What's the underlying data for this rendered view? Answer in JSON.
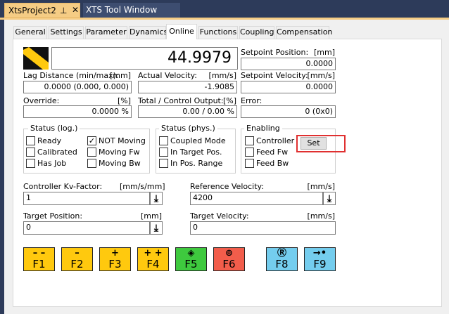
{
  "doc_tabs": [
    {
      "label": "XtsProject2",
      "pin": "⊥",
      "close": "✕"
    },
    {
      "label": "XTS Tool Window"
    }
  ],
  "prop_tabs": [
    "General",
    "Settings",
    "Parameter",
    "Dynamics",
    "Online",
    "Functions",
    "Coupling",
    "Compensation"
  ],
  "active_tab": "Online",
  "online": {
    "main_value": "44.9979",
    "setpoint_position": {
      "label": "Setpoint Position:",
      "unit": "[mm]",
      "value": "0.0000"
    },
    "lag_distance": {
      "label": "Lag Distance (min/max):",
      "unit": "[mm]",
      "value": "0.0000  (0.000, 0.000)"
    },
    "actual_velocity": {
      "label": "Actual Velocity:",
      "unit": "[mm/s]",
      "value": "-1.9085"
    },
    "setpoint_velocity": {
      "label": "Setpoint Velocity:",
      "unit": "[mm/s]",
      "value": "0.0000"
    },
    "override": {
      "label": "Override:",
      "unit": "[%]",
      "value": "0.0000 %"
    },
    "total_output": {
      "label": "Total / Control Output:",
      "unit": "[%]",
      "value": "0.00 /  0.00 %"
    },
    "error": {
      "label": "Error:",
      "value": "0 (0x0)"
    }
  },
  "status_log": {
    "title": "Status (log.)",
    "items": [
      {
        "label": "Ready",
        "checked": false
      },
      {
        "label": "Calibrated",
        "checked": false
      },
      {
        "label": "Has Job",
        "checked": false
      },
      {
        "label": "NOT Moving",
        "checked": true
      },
      {
        "label": "Moving Fw",
        "checked": false
      },
      {
        "label": "Moving Bw",
        "checked": false
      }
    ]
  },
  "status_phys": {
    "title": "Status (phys.)",
    "items": [
      {
        "label": "Coupled Mode",
        "checked": false
      },
      {
        "label": "In Target Pos.",
        "checked": false
      },
      {
        "label": "In Pos. Range",
        "checked": false
      }
    ]
  },
  "enabling": {
    "title": "Enabling",
    "items": [
      {
        "label": "Controller",
        "checked": false
      },
      {
        "label": "Feed Fw",
        "checked": false
      },
      {
        "label": "Feed Bw",
        "checked": false
      }
    ],
    "set_label": "Set"
  },
  "controller_kv": {
    "label": "Controller Kv-Factor:",
    "unit": "[mm/s/mm]",
    "value": "1"
  },
  "reference_velocity": {
    "label": "Reference Velocity:",
    "unit": "[mm/s]",
    "value": "4200"
  },
  "target_position": {
    "label": "Target Position:",
    "unit": "[mm]",
    "value": "0"
  },
  "target_velocity": {
    "label": "Target Velocity:",
    "unit": "[mm/s]",
    "value": "0"
  },
  "arrow_glyph": "⤓",
  "fkeys": [
    {
      "key": "F1",
      "symbol": "– –",
      "color": "#ffc90e",
      "icon": "fast-backward-icon"
    },
    {
      "key": "F2",
      "symbol": "–",
      "color": "#ffc90e",
      "icon": "backward-icon"
    },
    {
      "key": "F3",
      "symbol": "+",
      "color": "#ffc90e",
      "icon": "forward-icon"
    },
    {
      "key": "F4",
      "symbol": "+ +",
      "color": "#ffc90e",
      "icon": "fast-forward-icon"
    },
    {
      "key": "F5",
      "symbol": "◈",
      "color": "#3ec93e",
      "icon": "enable-icon"
    },
    {
      "key": "F6",
      "symbol": "⊚",
      "color": "#f25d4b",
      "icon": "stop-icon"
    },
    {
      "key": "F8",
      "symbol": "Ⓡ",
      "color": "#74cdee",
      "icon": "reset-icon"
    },
    {
      "key": "F9",
      "symbol": "→•",
      "color": "#74cdee",
      "icon": "home-icon"
    }
  ]
}
